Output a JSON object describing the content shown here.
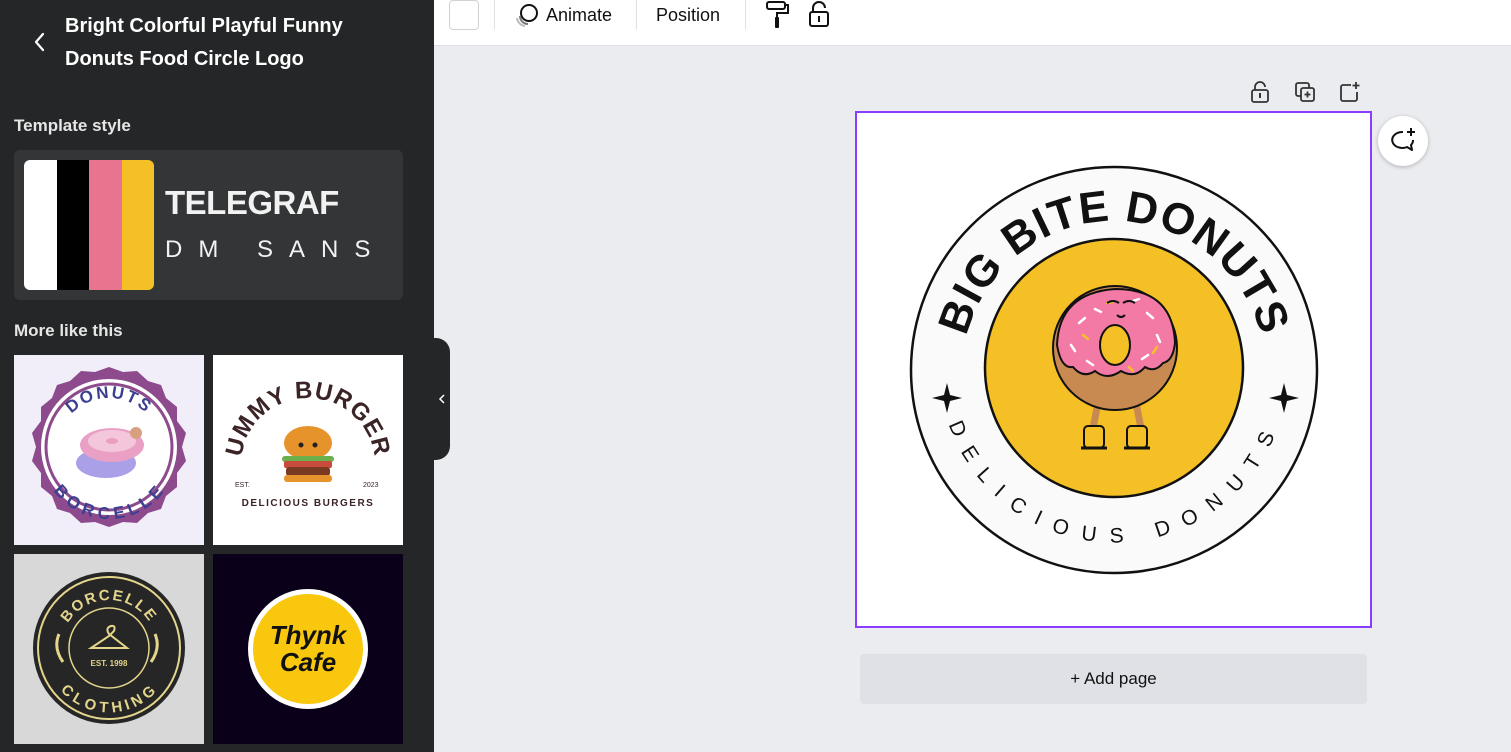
{
  "sidebar": {
    "title": "Bright Colorful Playful Funny Donuts Food Circle Logo",
    "template_style_heading": "Template style",
    "style_card": {
      "swatch_colors": [
        "#ffffff",
        "#000000",
        "#e87490",
        "#f4c025"
      ],
      "heading_font": "TELEGRAF",
      "body_font": "DM SANS"
    },
    "more_like_this_heading": "More like this",
    "thumbnails": [
      {
        "top_text": "DONUTS",
        "bottom_text": "BORCELLE"
      },
      {
        "top_text": "YUMMY BURGERS",
        "est": "EST.",
        "year": "2023",
        "bottom_text": "DELICIOUS BURGERS"
      },
      {
        "top_text": "BORCELLE",
        "est": "EST. 1998",
        "bottom_text": "CLOTHING"
      },
      {
        "line1": "Thynk",
        "line2": "Cafe"
      }
    ]
  },
  "toolbar": {
    "animate_label": "Animate",
    "position_label": "Position",
    "icons": [
      "color-swatch-icon",
      "animate-icon",
      "paint-roller-icon",
      "lock-icon"
    ]
  },
  "canvas": {
    "logo_top_text": "BIG BITE DONUTS",
    "logo_bottom_text": "DELICIOUS DONUTS",
    "accent_color": "#8b3dff",
    "logo_yellow": "#f4c025",
    "donut_pink": "#f47aa6",
    "page_tool_icons": [
      "lock-icon",
      "duplicate-icon",
      "add-page-icon"
    ],
    "add_page_label": "+ Add page"
  }
}
